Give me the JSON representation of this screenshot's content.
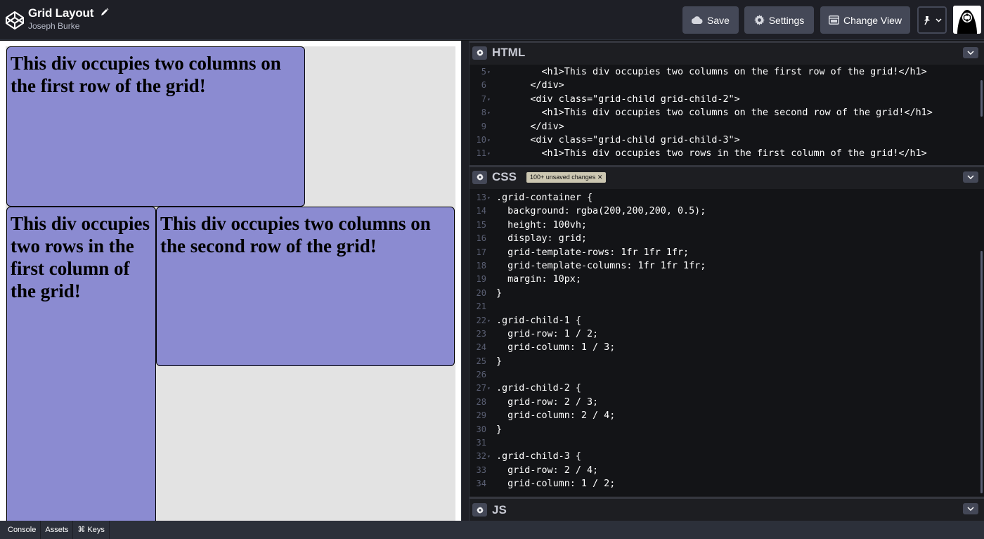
{
  "header": {
    "title": "Grid Layout",
    "author": "Joseph Burke",
    "save_label": "Save",
    "settings_label": "Settings",
    "change_view_label": "Change View"
  },
  "preview": {
    "child1": "This div occupies two columns on the first row of the grid!",
    "child2": "This div occupies two columns on the second row of the grid!",
    "child3": "This div occupies two rows in the first column of the grid!"
  },
  "editors": {
    "html": {
      "label": "HTML",
      "lines": [
        {
          "n": "5",
          "fold": true,
          "text": "        <h1>This div occupies two columns on the first row of the grid!</h1>"
        },
        {
          "n": "6",
          "fold": false,
          "text": "      </div>"
        },
        {
          "n": "7",
          "fold": true,
          "text": "      <div class=\"grid-child grid-child-2\">"
        },
        {
          "n": "8",
          "fold": true,
          "text": "        <h1>This div occupies two columns on the second row of the grid!</h1>"
        },
        {
          "n": "9",
          "fold": false,
          "text": "      </div>"
        },
        {
          "n": "10",
          "fold": true,
          "text": "      <div class=\"grid-child grid-child-3\">"
        },
        {
          "n": "11",
          "fold": true,
          "text": "        <h1>This div occupies two rows in the first column of the grid!</h1>"
        }
      ]
    },
    "css": {
      "label": "CSS",
      "unsaved": "100+ unsaved changes",
      "lines": [
        {
          "n": "13",
          "fold": true,
          "text": ".grid-container {"
        },
        {
          "n": "14",
          "fold": false,
          "text": "  background: rgba(200,200,200, 0.5);"
        },
        {
          "n": "15",
          "fold": false,
          "text": "  height: 100vh;"
        },
        {
          "n": "16",
          "fold": false,
          "text": "  display: grid;"
        },
        {
          "n": "17",
          "fold": false,
          "text": "  grid-template-rows: 1fr 1fr 1fr;"
        },
        {
          "n": "18",
          "fold": false,
          "text": "  grid-template-columns: 1fr 1fr 1fr;"
        },
        {
          "n": "19",
          "fold": false,
          "text": "  margin: 10px;"
        },
        {
          "n": "20",
          "fold": false,
          "text": "}"
        },
        {
          "n": "21",
          "fold": false,
          "text": ""
        },
        {
          "n": "22",
          "fold": true,
          "text": ".grid-child-1 {"
        },
        {
          "n": "23",
          "fold": false,
          "text": "  grid-row: 1 / 2;"
        },
        {
          "n": "24",
          "fold": false,
          "text": "  grid-column: 1 / 3;"
        },
        {
          "n": "25",
          "fold": false,
          "text": "}"
        },
        {
          "n": "26",
          "fold": false,
          "text": ""
        },
        {
          "n": "27",
          "fold": true,
          "text": ".grid-child-2 {"
        },
        {
          "n": "28",
          "fold": false,
          "text": "  grid-row: 2 / 3;"
        },
        {
          "n": "29",
          "fold": false,
          "text": "  grid-column: 2 / 4;"
        },
        {
          "n": "30",
          "fold": false,
          "text": "}"
        },
        {
          "n": "31",
          "fold": false,
          "text": ""
        },
        {
          "n": "32",
          "fold": true,
          "text": ".grid-child-3 {"
        },
        {
          "n": "33",
          "fold": false,
          "text": "  grid-row: 2 / 4;"
        },
        {
          "n": "34",
          "fold": false,
          "text": "  grid-column: 1 / 2;"
        }
      ]
    },
    "js": {
      "label": "JS"
    }
  },
  "footer": {
    "console": "Console",
    "assets": "Assets",
    "keys": "⌘ Keys"
  },
  "colors": {
    "accent_box": "#8b8bd1",
    "editor_bg": "#131417",
    "header_bg": "#1e1f26"
  }
}
